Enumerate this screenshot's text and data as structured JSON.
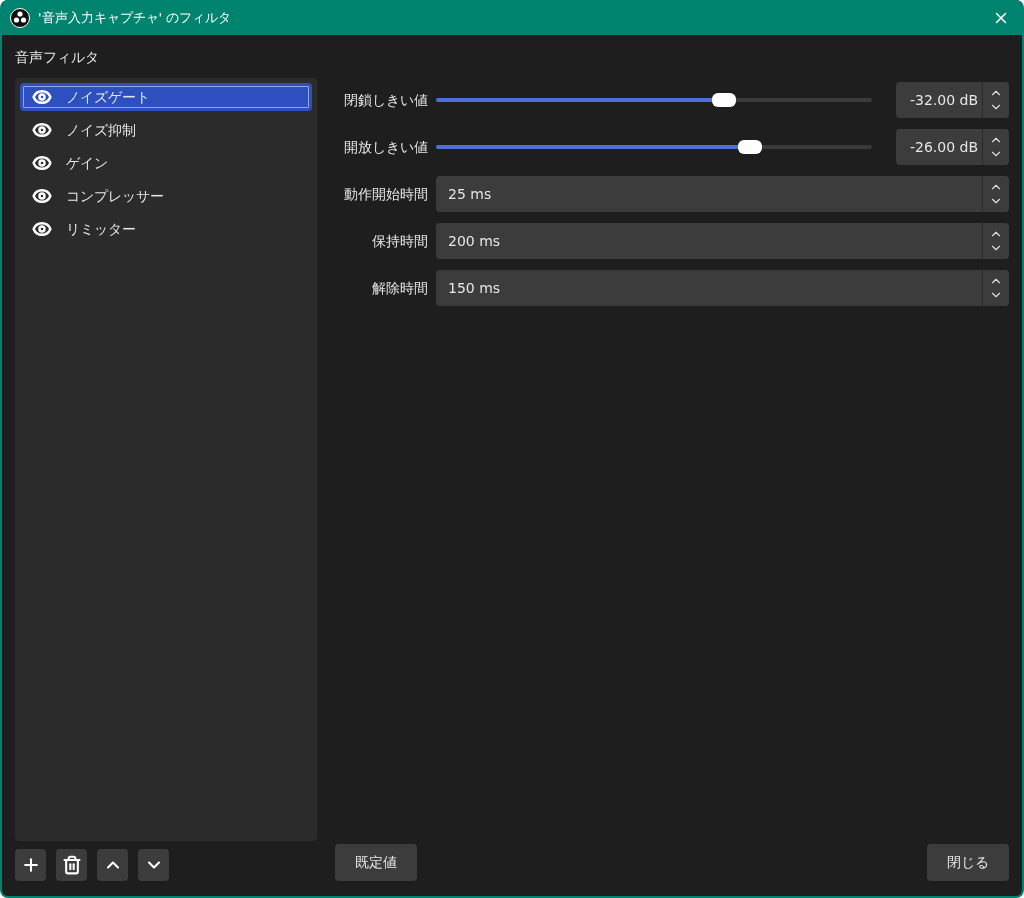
{
  "window": {
    "title": "'音声入力キャプチャ' のフィルタ"
  },
  "section_label": "音声フィルタ",
  "filters": [
    {
      "name": "ノイズゲート",
      "visible": true,
      "selected": true
    },
    {
      "name": "ノイズ抑制",
      "visible": true,
      "selected": false
    },
    {
      "name": "ゲイン",
      "visible": true,
      "selected": false
    },
    {
      "name": "コンプレッサー",
      "visible": true,
      "selected": false
    },
    {
      "name": "リミッター",
      "visible": true,
      "selected": false
    }
  ],
  "properties": [
    {
      "kind": "slider",
      "label": "閉鎖しきい値",
      "level": 0.66,
      "value": "-32.00 dB"
    },
    {
      "kind": "slider",
      "label": "開放しきい値",
      "level": 0.72,
      "value": "-26.00 dB"
    },
    {
      "kind": "spin",
      "label": "動作開始時間",
      "value": "25 ms"
    },
    {
      "kind": "spin",
      "label": "保持時間",
      "value": "200 ms"
    },
    {
      "kind": "spin",
      "label": "解除時間",
      "value": "150 ms"
    }
  ],
  "buttons": {
    "defaults": "既定値",
    "close": "閉じる"
  }
}
